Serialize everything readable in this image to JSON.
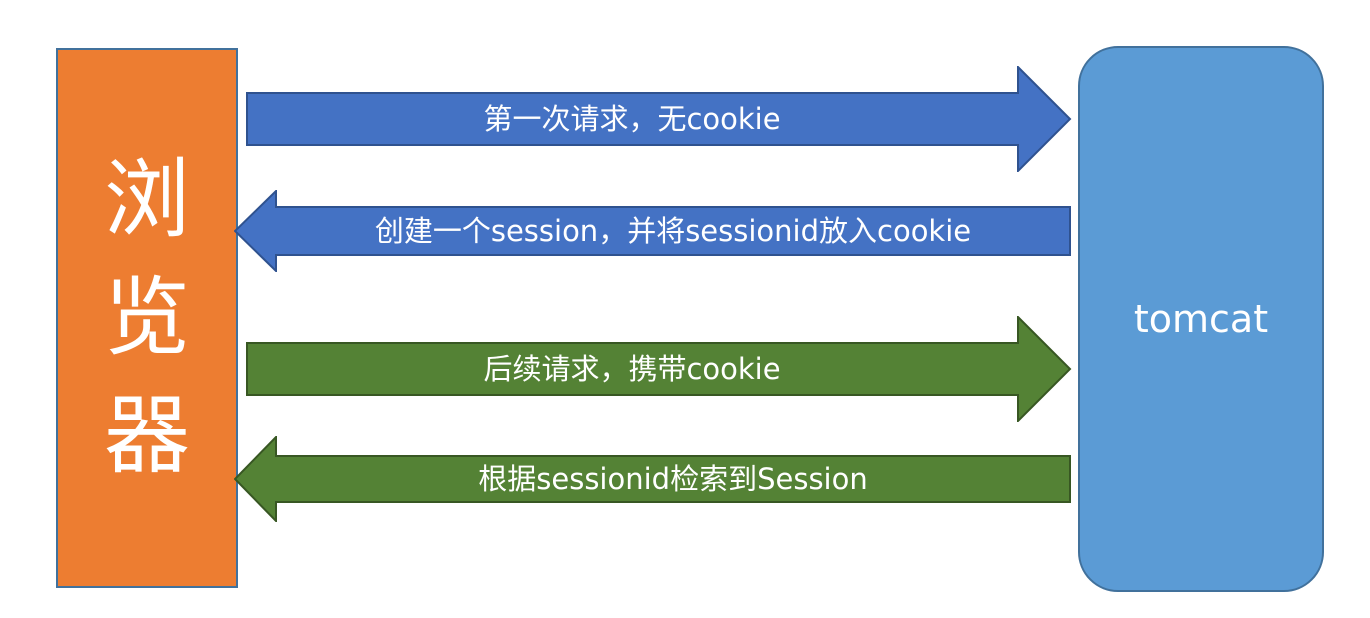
{
  "colors": {
    "browser_fill": "#ed7d31",
    "server_fill": "#5b9bd5",
    "blue_arrow": "#4472c4",
    "green_arrow": "#548235",
    "outline": "#41719c"
  },
  "browser": {
    "label": "浏览器"
  },
  "server": {
    "label": "tomcat"
  },
  "arrows": [
    {
      "label": "第一次请求，无cookie",
      "direction": "right",
      "color": "#4472c4"
    },
    {
      "label": "创建一个session，并将sessionid放入cookie",
      "direction": "left",
      "color": "#4472c4"
    },
    {
      "label": "后续请求，携带cookie",
      "direction": "right",
      "color": "#548235"
    },
    {
      "label": "根据sessionid检索到Session",
      "direction": "left",
      "color": "#548235"
    }
  ]
}
